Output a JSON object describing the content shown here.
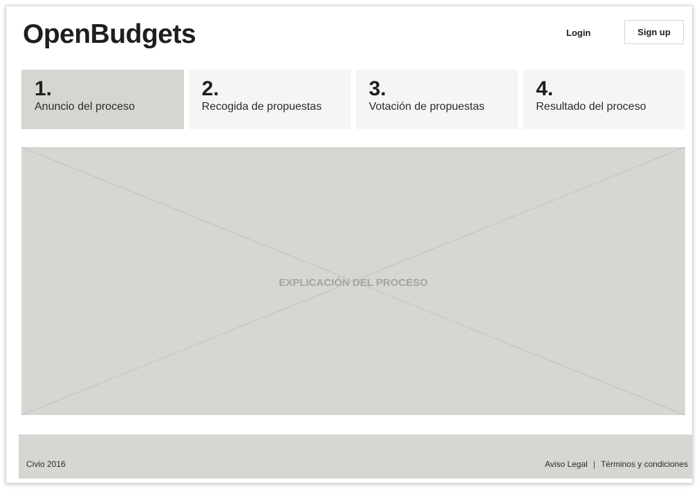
{
  "header": {
    "logo": "OpenBudgets",
    "login_label": "Login",
    "signup_label": "Sign up"
  },
  "steps": [
    {
      "number": "1.",
      "label": "Anuncio del proceso",
      "active": true
    },
    {
      "number": "2.",
      "label": "Recogida de propuestas",
      "active": false
    },
    {
      "number": "3.",
      "label": "Votación de propuestas",
      "active": false
    },
    {
      "number": "4.",
      "label": "Resultado del proceso",
      "active": false
    }
  ],
  "main": {
    "placeholder_text": "EXPLICACIÓN DEL PROCESO"
  },
  "footer": {
    "copyright": "Civio 2016",
    "links": [
      "Aviso Legal",
      "Términos y condiciones"
    ],
    "separator": "|"
  },
  "colors": {
    "active_step": "#d5d5d1",
    "inactive_step": "#f5f5f4",
    "placeholder": "#d6d6d2",
    "footer": "#d6d6d2"
  }
}
